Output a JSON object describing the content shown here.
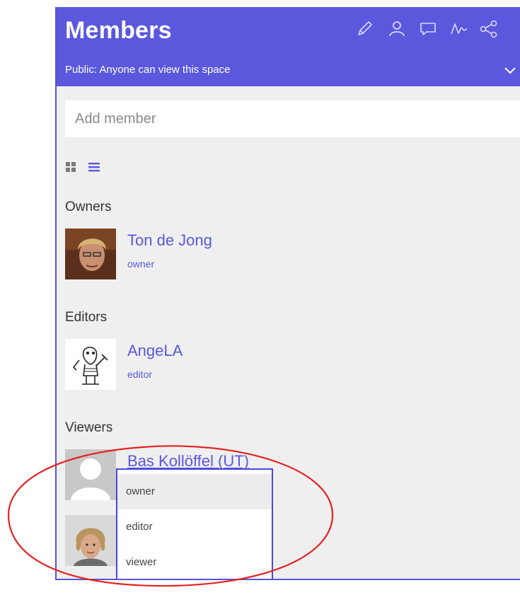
{
  "header": {
    "title": "Members",
    "visibility": "Public: Anyone can view this space",
    "icons": [
      "pencil-icon",
      "person-icon",
      "comment-icon",
      "activity-icon",
      "share-icon"
    ],
    "accent_color": "#5b58dd"
  },
  "add_member": {
    "placeholder": "Add member"
  },
  "view_toggle": {
    "grid": "grid-view-icon",
    "list": "list-view-icon",
    "active": "list"
  },
  "sections": {
    "owners": {
      "title": "Owners",
      "members": [
        {
          "name": "Ton de Jong",
          "role": "owner"
        }
      ]
    },
    "editors": {
      "title": "Editors",
      "members": [
        {
          "name": "AngeLA",
          "role": "editor",
          "remove": "×"
        }
      ]
    },
    "viewers": {
      "title": "Viewers",
      "members": [
        {
          "name": "Bas Kollöffel (UT)",
          "remove": "×"
        },
        {
          "remove": "×"
        }
      ]
    }
  },
  "role_dropdown": {
    "options": [
      "owner",
      "editor",
      "viewer"
    ],
    "highlighted": "owner"
  },
  "annotation": {
    "color": "#e52222",
    "shape": "ellipse"
  }
}
